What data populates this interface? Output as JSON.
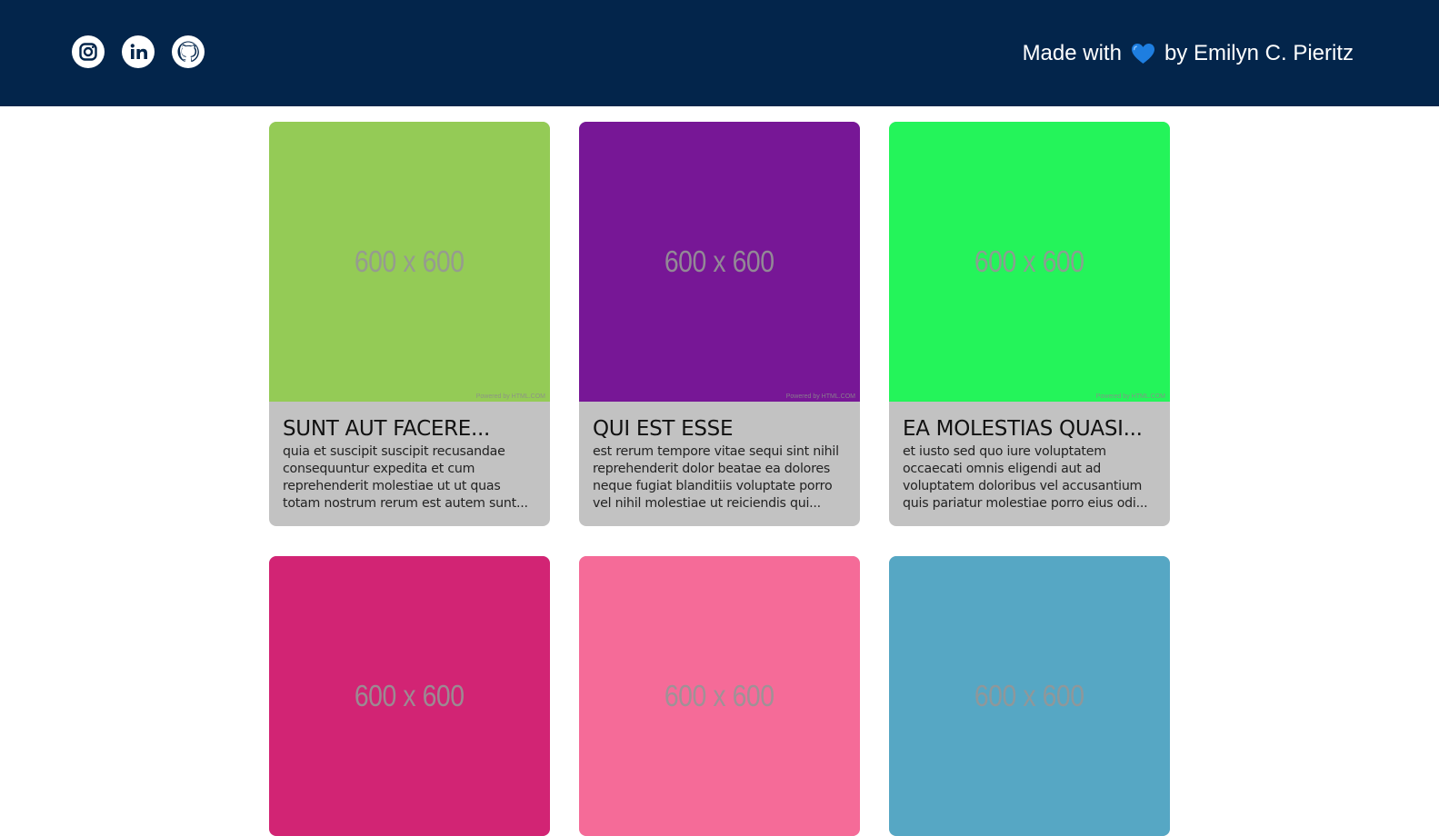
{
  "header": {
    "social": [
      {
        "name": "instagram",
        "icon": "instagram-icon"
      },
      {
        "name": "linkedin",
        "icon": "linkedin-icon"
      },
      {
        "name": "github",
        "icon": "github-icon"
      }
    ],
    "credits": {
      "prefix": "Made with",
      "heart_icon": "blue-heart-icon",
      "suffix": "by Emilyn C. Pieritz"
    },
    "background": "#03254b"
  },
  "cards": [
    {
      "color": "#94cb56",
      "image_text": "600 x 600",
      "powered_text": "Powered by HTML.COM",
      "title": "SUNT AUT FACERE...",
      "body": "quia et suscipit suscipit recusandae consequuntur expedita et cum reprehenderit molestiae ut ut quas totam nostrum rerum est autem sunt..."
    },
    {
      "color": "#771796",
      "image_text": "600 x 600",
      "powered_text": "Powered by HTML.COM",
      "title": "QUI EST ESSE",
      "body": "est rerum tempore vitae sequi sint nihil reprehenderit dolor beatae ea dolores neque fugiat blanditiis voluptate porro vel nihil molestiae ut reiciendis qui..."
    },
    {
      "color": "#24f45a",
      "image_text": "600 x 600",
      "powered_text": "Powered by HTML.COM",
      "title": "EA MOLESTIAS QUASI...",
      "body": "et iusto sed quo iure voluptatem occaecati omnis eligendi aut ad voluptatem doloribus vel accusantium quis pariatur molestiae porro eius odi..."
    },
    {
      "color": "#d22474",
      "image_text": "600 x 600",
      "powered_text": "",
      "title": "",
      "body": ""
    },
    {
      "color": "#f56b98",
      "image_text": "600 x 600",
      "powered_text": "",
      "title": "",
      "body": ""
    },
    {
      "color": "#56a7c4",
      "image_text": "600 x 600",
      "powered_text": "",
      "title": "",
      "body": ""
    }
  ]
}
